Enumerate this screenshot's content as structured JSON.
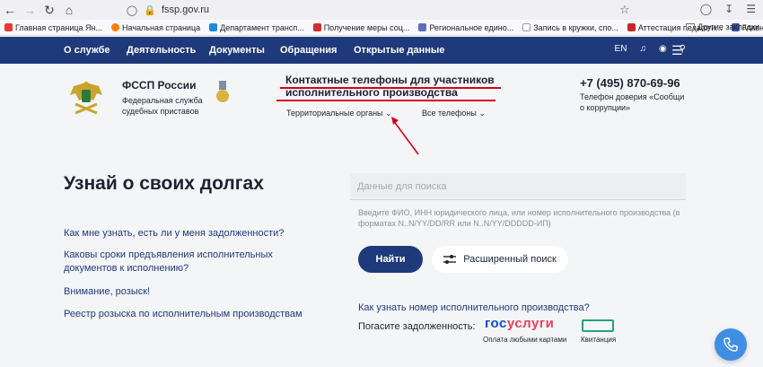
{
  "browser": {
    "url": "fssp.gov.ru",
    "bookmarks": [
      {
        "label": "Главная страница Ян...",
        "color": "#e53935"
      },
      {
        "label": "Начальная страница",
        "color": "#ff7a00"
      },
      {
        "label": "Департамент трансп...",
        "color": "#1e88e5"
      },
      {
        "label": "Получение меры соц...",
        "color": "#d32f2f"
      },
      {
        "label": "Региональное едино...",
        "color": "#5c6bc0"
      },
      {
        "label": "Запись в кружки, спо...",
        "color": "#9e9e9e"
      },
      {
        "label": "Аттестация педагоги...",
        "color": "#c62828"
      },
      {
        "label": "Главная",
        "color": "#3949ab"
      }
    ],
    "other_bookmarks": "Другие закладки"
  },
  "site_nav": {
    "items": [
      "О службе",
      "Деятельность",
      "Документы",
      "Обращения",
      "Открытые данные"
    ],
    "lang": "EN"
  },
  "header": {
    "org_title": "ФССП России",
    "org_subtitle": "Федеральная служба судебных приставов",
    "contacts_title": "Контактные телефоны для участников исполнительного производства",
    "dropdown_territorial": "Территориальные органы",
    "dropdown_all_phones": "Все телефоны",
    "hotline": "+7 (495) 870-69-96",
    "hotline_subtitle": "Телефон доверия «Сообщи о коррупции»"
  },
  "main": {
    "title": "Узнай о своих долгах",
    "faq": [
      "Как мне узнать, есть ли у меня задолженности?",
      "Каковы сроки предъявления исполнительных документов к исполнению?",
      "Внимание, розыск!",
      "Реестр розыска по исполнительным производствам"
    ],
    "search_placeholder": "Данные для поиска",
    "search_hint": "Введите ФИО, ИНН юридического лица, или номер исполнительного производства (в форматах N..N/YY/DD/RR или N..N/YY/DDDDD-ИП)",
    "find_button": "Найти",
    "advanced_button": "Расширенный поиск",
    "how_to_know": "Как узнать номер исполнительного производства?",
    "pay_label": "Погасите задолженность:",
    "gosuslugi_part1": "гос",
    "gosuslugi_part2": "услуги",
    "gosuslugi_sub": "Оплата любыми картами",
    "receipt_sub": "Квитанция"
  }
}
